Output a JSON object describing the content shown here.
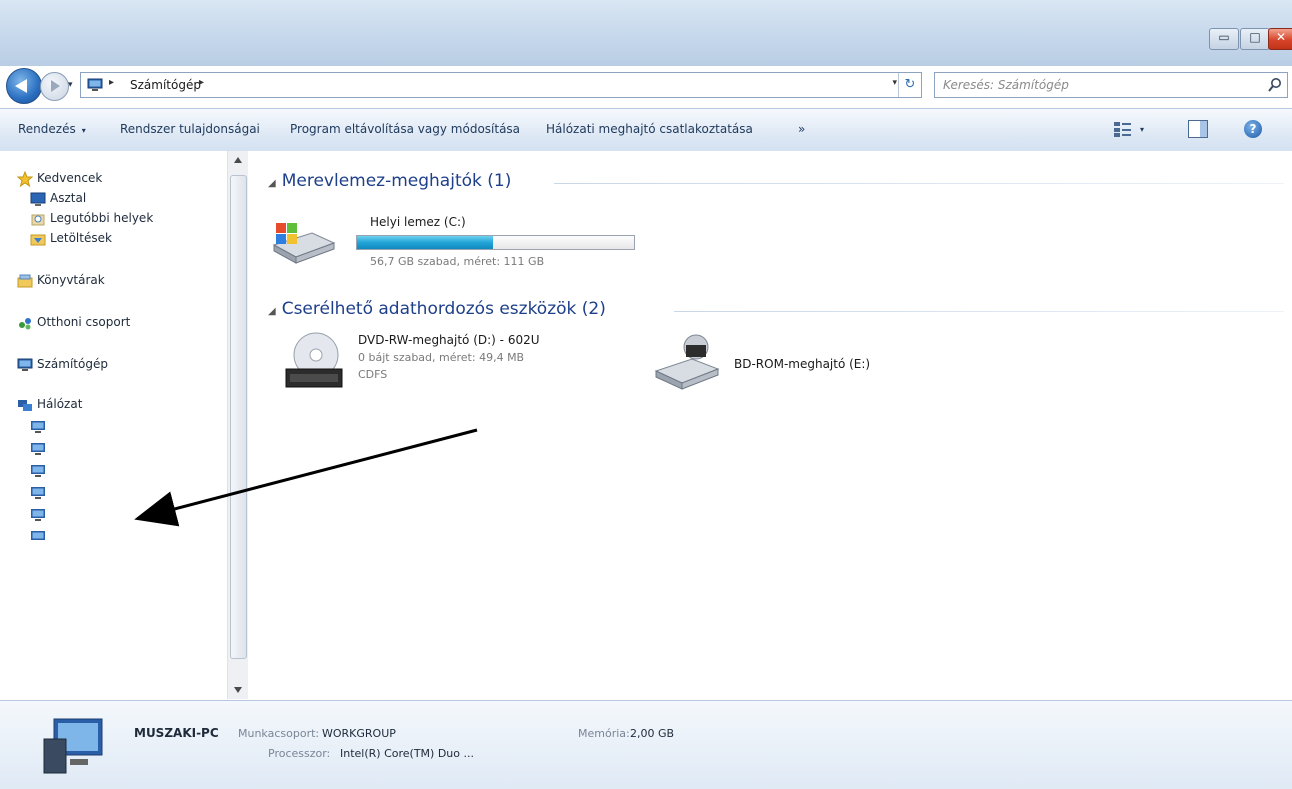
{
  "window": {
    "controls": {
      "minimize": "▭",
      "maximize": "□",
      "close": "✕"
    }
  },
  "address": {
    "crumb": "Számítógép",
    "separator": "▸",
    "dropdown": "▾",
    "refresh": "↻"
  },
  "search": {
    "placeholder": "Keresés: Számítógép"
  },
  "toolbar": {
    "organize": "Rendezés",
    "system_properties": "Rendszer tulajdonságai",
    "uninstall": "Program eltávolítása vagy módosítása",
    "map_drive": "Hálózati meghajtó csatlakoztatása",
    "more": "»",
    "view_dropdown": "▾",
    "help": "?"
  },
  "nav": {
    "favorites": "Kedvencek",
    "desktop": "Asztal",
    "recent": "Legutóbbi helyek",
    "downloads": "Letöltések",
    "libraries": "Könyvtárak",
    "homegroup": "Otthoni csoport",
    "computer": "Számítógép",
    "network": "Hálózat"
  },
  "groups": {
    "hdd": "Merevlemez-meghajtók (1)",
    "removable": "Cserélhető adathordozós eszközök (2)"
  },
  "drives": {
    "c": {
      "name": "Helyi lemez (C:)",
      "info": "56,7 GB szabad, méret: 111 GB",
      "used_fraction": 0.49
    },
    "d": {
      "name": "DVD-RW-meghajtó (D:) - 602U",
      "info": "0 bájt szabad, méret: 49,4 MB",
      "fs": "CDFS"
    },
    "e": {
      "name": "BD-ROM-meghajtó (E:)"
    }
  },
  "details": {
    "pc_name": "MUSZAKI-PC",
    "workgroup_label": "Munkacsoport:",
    "workgroup": "WORKGROUP",
    "memory_label": "Memória:",
    "memory": "2,00 GB",
    "processor_label": "Processzor:",
    "processor": "Intel(R) Core(TM) Duo ..."
  },
  "colors": {
    "accent": "#1e3f8a",
    "bar_fill": "#23a5d8",
    "window_frame": "#c6d8ec"
  }
}
